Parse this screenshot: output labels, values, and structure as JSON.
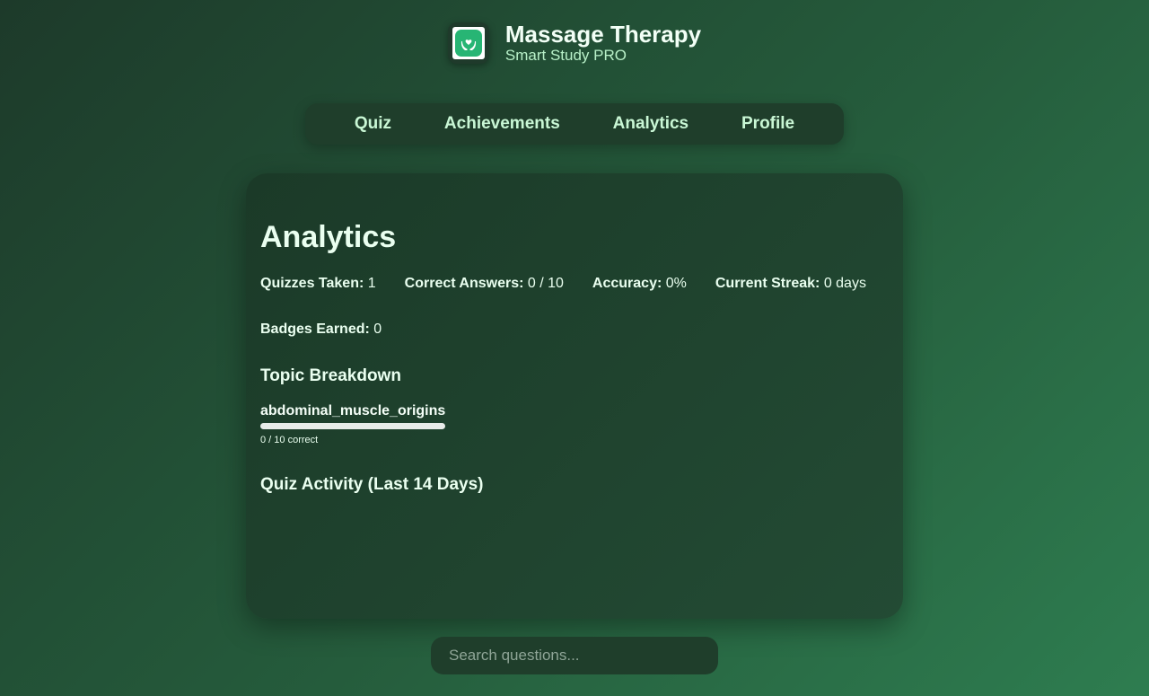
{
  "brand": {
    "title": "Massage Therapy",
    "subtitle": "Smart Study PRO",
    "logo_icon": "hands-heart-icon"
  },
  "nav": {
    "items": [
      {
        "label": "Quiz"
      },
      {
        "label": "Achievements"
      },
      {
        "label": "Analytics"
      },
      {
        "label": "Profile"
      }
    ]
  },
  "analytics": {
    "title": "Analytics",
    "stats": {
      "quizzes_taken_label": "Quizzes Taken:",
      "quizzes_taken_value": "1",
      "correct_answers_label": "Correct Answers:",
      "correct_answers_value": "0 / 10",
      "accuracy_label": "Accuracy:",
      "accuracy_value": "0%",
      "current_streak_label": "Current Streak:",
      "current_streak_value": "0 days",
      "badges_earned_label": "Badges Earned:",
      "badges_earned_value": "0"
    },
    "topic_breakdown_heading": "Topic Breakdown",
    "topics": [
      {
        "name": "abdominal_muscle_origins",
        "count_text": "0 / 10 correct",
        "progress": 0
      }
    ],
    "activity_heading": "Quiz Activity (Last 14 Days)"
  },
  "search": {
    "placeholder": "Search questions...",
    "value": ""
  },
  "colors": {
    "accent": "#27b574",
    "nav_text": "#c9f7d5"
  }
}
